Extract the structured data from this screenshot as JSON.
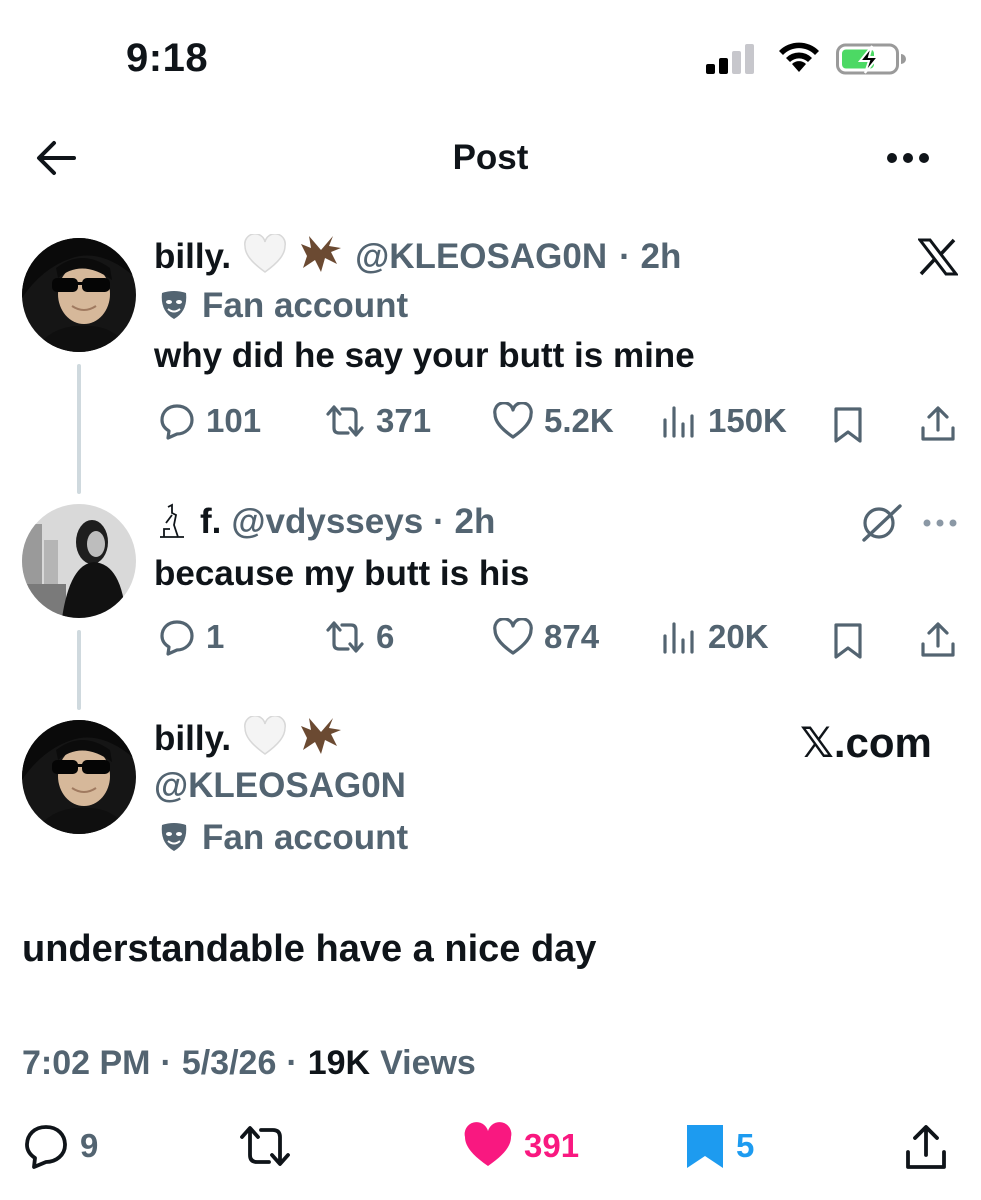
{
  "status_bar": {
    "time": "9:18"
  },
  "header": {
    "title": "Post"
  },
  "tweet1": {
    "name": "billy.",
    "handle": "@KLEOSAG0N",
    "time": "· 2h",
    "fan_label": "Fan account",
    "text": "why did he say your butt is mine",
    "replies": "101",
    "reposts": "371",
    "likes": "5.2K",
    "views": "150K"
  },
  "tweet2": {
    "name": "f.",
    "handle": "@vdysseys",
    "time": "· 2h",
    "text": "because my butt is his",
    "replies": "1",
    "reposts": "6",
    "likes": "874",
    "views": "20K"
  },
  "main_post": {
    "name": "billy.",
    "handle": "@KLEOSAG0N",
    "fan_label": "Fan account",
    "watermark": "𝕏.com",
    "text": "understandable have a nice day",
    "time": "7:02 PM",
    "date": "5/3/26",
    "views_count": "19K",
    "views_label": "Views",
    "replies": "9",
    "likes": "391",
    "bookmarks": "5"
  },
  "colors": {
    "like": "#f91880",
    "bookmark": "#1d9bf0",
    "secondary": "#536471"
  }
}
